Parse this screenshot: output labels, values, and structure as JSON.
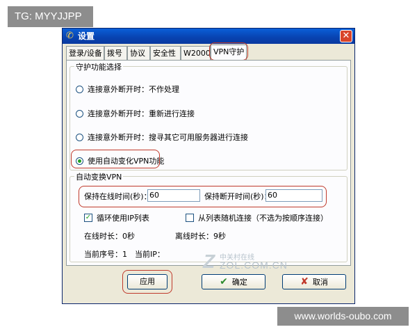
{
  "overlay": {
    "top_tag": "TG: MYYJJPP",
    "bottom_tag": "www.worlds-oubo.com"
  },
  "window": {
    "title": "设置",
    "close_label": "✕"
  },
  "tabs": [
    {
      "label": "登录/设备"
    },
    {
      "label": "拨号"
    },
    {
      "label": "协议"
    },
    {
      "label": "安全性"
    },
    {
      "label": "W2000"
    },
    {
      "label": "VPN守护",
      "active": true
    }
  ],
  "guard": {
    "group_label": "守护功能选择",
    "options": [
      {
        "label": "连接意外断开时：不作处理",
        "checked": false
      },
      {
        "label": "连接意外断开时：重新进行连接",
        "checked": false
      },
      {
        "label": "连接意外断开时：搜寻其它可用服务器进行连接",
        "checked": false
      },
      {
        "label": "使用自动变化VPN功能",
        "checked": true
      }
    ]
  },
  "auto_switch": {
    "group_label": "自动变换VPN",
    "online_time_label": "保持在线时间(秒)：",
    "online_time_value": "60",
    "offline_time_label": "保持断开时间(秒)：",
    "offline_time_value": "60",
    "loop_ip_label": "循环使用IP列表",
    "loop_ip_checked": true,
    "random_label": "从列表随机连接（不选为按顺序连接）",
    "random_checked": false,
    "online_duration": "在线时长：0秒",
    "offline_duration": "离线时长：9秒",
    "current_index": "当前序号：1",
    "current_ip": "当前IP："
  },
  "buttons": {
    "apply": "应用",
    "ok": "确定",
    "cancel": "取消"
  },
  "watermark": {
    "logo_letter": "Z",
    "brand_cn": "中关村在线",
    "brand_url": "ZOL.COM.CN"
  },
  "colors": {
    "highlight": "#c0392b",
    "titlebar": "#0a5fd8",
    "window_bg": "#ece9d8"
  }
}
